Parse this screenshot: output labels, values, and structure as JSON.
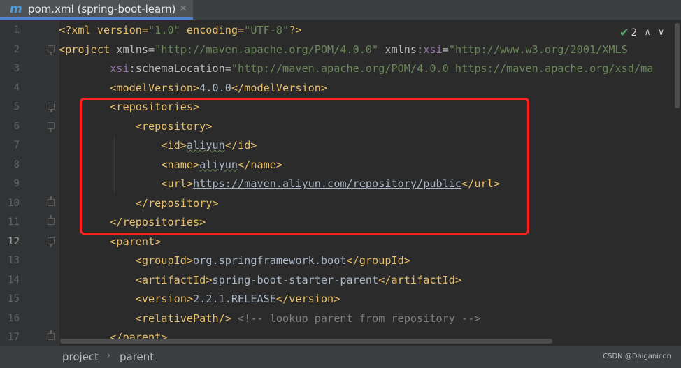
{
  "tab": {
    "icon": "maven-m-icon",
    "icon_glyph": "m",
    "title": "pom.xml (spring-boot-learn)",
    "close": "×"
  },
  "inspection": {
    "count": "2",
    "check_glyph": "✔",
    "up_glyph": "∧",
    "down_glyph": "∨"
  },
  "line_numbers": [
    "1",
    "2",
    "3",
    "4",
    "5",
    "6",
    "7",
    "8",
    "9",
    "10",
    "11",
    "12",
    "13",
    "14",
    "15",
    "16",
    "17"
  ],
  "code": {
    "l1": {
      "a": "<?xml version=",
      "b": "\"1.0\"",
      "c": " encoding=",
      "d": "\"UTF-8\"",
      "e": "?>"
    },
    "l2": {
      "a": "<project ",
      "b": "xmlns=",
      "c": "\"http://maven.apache.org/POM/4.0.0\"",
      "d": " xmlns:",
      "e": "xsi",
      "f": "=",
      "g": "\"http://www.w3.org/2001/XMLS"
    },
    "l3": {
      "a": "xsi",
      "b": ":schemaLocation=",
      "c": "\"http://maven.apache.org/POM/4.0.0 https://maven.apache.org/xsd/ma"
    },
    "l4": {
      "a": "<modelVersion>",
      "b": "4.0.0",
      "c": "</modelVersion>"
    },
    "l5": {
      "a": "<repositories>"
    },
    "l6": {
      "a": "<repository>"
    },
    "l7": {
      "a": "<id>",
      "b": "aliyun",
      "c": "</id>"
    },
    "l8": {
      "a": "<name>",
      "b": "aliyun",
      "c": "</name>"
    },
    "l9": {
      "a": "<url>",
      "b": "https://maven.aliyun.com/repository/public",
      "c": "</url>"
    },
    "l10": {
      "a": "</repository>"
    },
    "l11": {
      "a": "</repositories>"
    },
    "l12": {
      "a": "<parent>"
    },
    "l13": {
      "a": "<groupId>",
      "b": "org.springframework.boot",
      "c": "</groupId>"
    },
    "l14": {
      "a": "<artifactId>",
      "b": "spring-boot-starter-parent",
      "c": "</artifactId>"
    },
    "l15": {
      "a": "<version>",
      "b": "2.2.1.RELEASE",
      "c": "</version>"
    },
    "l16": {
      "a": "<relativePath/>",
      "b": " <!-- lookup parent from repository -->"
    },
    "l17": {
      "a": "</parent>"
    }
  },
  "breadcrumb": {
    "items": [
      "project",
      "parent"
    ],
    "separator": "›"
  },
  "watermark": "CSDN @Daiganicon",
  "colors": {
    "tag": "#e8bf6a",
    "value": "#6a8759",
    "namespace": "#9876aa",
    "highlight": "#ff2020",
    "background": "#2b2b2b"
  }
}
